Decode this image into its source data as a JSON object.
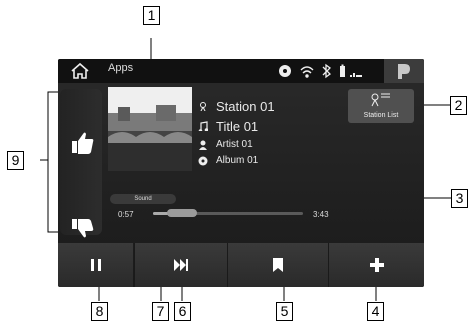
{
  "topbar": {
    "home_icon": "home-icon",
    "apps_label": "Apps",
    "status_icons": [
      "disc-icon",
      "wifi-icon",
      "bluetooth-icon",
      "battery-icon",
      "signal-icon"
    ],
    "profile_icon": "p-logo-icon"
  },
  "side_panel": {
    "like_icon": "thumbs-up-icon",
    "dislike_icon": "thumbs-down-icon"
  },
  "now_playing": {
    "station": "Station 01",
    "title": "Title 01",
    "artist": "Artist 01",
    "album": "Album 01",
    "icons": [
      "antenna-icon",
      "music-note-icon",
      "person-icon",
      "disc-icon"
    ]
  },
  "station_list": {
    "label": "Station List",
    "icon": "antenna-list-icon"
  },
  "sound_button": {
    "label": "Sound"
  },
  "progress": {
    "elapsed": "0:57",
    "total": "3:43",
    "fraction": 0.26
  },
  "controls": {
    "buttons": [
      {
        "icon": "pause-icon"
      },
      {
        "icon": "skip-forward-icon"
      },
      {
        "icon": "bookmark-icon"
      },
      {
        "icon": "plus-icon"
      }
    ]
  },
  "callouts": [
    "1",
    "2",
    "3",
    "4",
    "5",
    "6",
    "7",
    "8",
    "9"
  ]
}
